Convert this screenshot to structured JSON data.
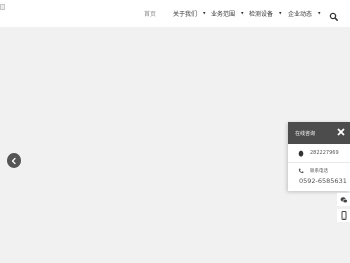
{
  "header": {
    "nav": [
      {
        "label": "首页",
        "has_dropdown": false,
        "active": true
      },
      {
        "label": "关于我们",
        "has_dropdown": true
      },
      {
        "label": "业务范围",
        "has_dropdown": true
      },
      {
        "label": "检测设备",
        "has_dropdown": true
      },
      {
        "label": "企业动态",
        "has_dropdown": true
      }
    ],
    "caret": "▾",
    "icons": {
      "search": "search-icon",
      "logo": "broken-image-icon"
    }
  },
  "hero": {
    "prev_icon": "chevron-left-icon",
    "background": "#f1f1f1"
  },
  "service_panel": {
    "title": "在线咨询",
    "qq_number": "282227969",
    "phone_label": "联系电话",
    "phone_number": "0592-6585631",
    "icons": {
      "close": "close-x-icon",
      "qq": "qq-penguin-icon",
      "phone": "phone-icon"
    }
  },
  "side_tools": {
    "icons": [
      "wechat-icon",
      "mobile-icon"
    ]
  },
  "colors": {
    "panel_header": "#4c4c4c",
    "arrow_bg": "#555555",
    "page_bg": "#f1f1f1",
    "active_nav": "#8a8a8a"
  }
}
